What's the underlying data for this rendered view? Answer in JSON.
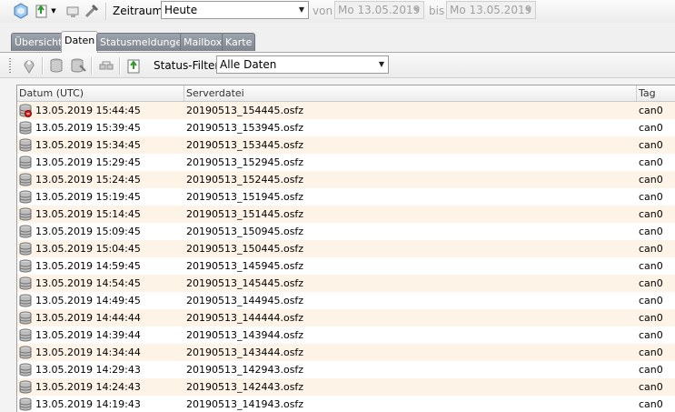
{
  "toolbar": {
    "zeitraum_label": "Zeitraum",
    "zeitraum_value": "Heute",
    "von_label": "von",
    "von_value": "Mo 13.05.2019",
    "bis_label": "bis",
    "bis_value": "Mo 13.05.2019"
  },
  "tabs": [
    {
      "label": "Übersicht"
    },
    {
      "label": "Daten"
    },
    {
      "label": "Statusmeldungen"
    },
    {
      "label": "Mailbox"
    },
    {
      "label": "Karte"
    }
  ],
  "filter": {
    "label": "Status-Filter:",
    "value": "Alle Daten"
  },
  "grid": {
    "columns": [
      "Datum (UTC)",
      "Serverdatei",
      "Tag"
    ],
    "rows": [
      {
        "date": "13.05.2019 15:44:45",
        "file": "20190513_154445.osfz",
        "tag": "can0",
        "icon": "database-alert-icon"
      },
      {
        "date": "13.05.2019 15:39:45",
        "file": "20190513_153945.osfz",
        "tag": "can0",
        "icon": "database-icon"
      },
      {
        "date": "13.05.2019 15:34:45",
        "file": "20190513_153445.osfz",
        "tag": "can0",
        "icon": "database-icon"
      },
      {
        "date": "13.05.2019 15:29:45",
        "file": "20190513_152945.osfz",
        "tag": "can0",
        "icon": "database-icon"
      },
      {
        "date": "13.05.2019 15:24:45",
        "file": "20190513_152445.osfz",
        "tag": "can0",
        "icon": "database-icon"
      },
      {
        "date": "13.05.2019 15:19:45",
        "file": "20190513_151945.osfz",
        "tag": "can0",
        "icon": "database-icon"
      },
      {
        "date": "13.05.2019 15:14:45",
        "file": "20190513_151445.osfz",
        "tag": "can0",
        "icon": "database-icon"
      },
      {
        "date": "13.05.2019 15:09:45",
        "file": "20190513_150945.osfz",
        "tag": "can0",
        "icon": "database-icon"
      },
      {
        "date": "13.05.2019 15:04:45",
        "file": "20190513_150445.osfz",
        "tag": "can0",
        "icon": "database-icon"
      },
      {
        "date": "13.05.2019 14:59:45",
        "file": "20190513_145945.osfz",
        "tag": "can0",
        "icon": "database-icon"
      },
      {
        "date": "13.05.2019 14:54:45",
        "file": "20190513_145445.osfz",
        "tag": "can0",
        "icon": "database-icon"
      },
      {
        "date": "13.05.2019 14:49:45",
        "file": "20190513_144945.osfz",
        "tag": "can0",
        "icon": "database-icon"
      },
      {
        "date": "13.05.2019 14:44:44",
        "file": "20190513_144444.osfz",
        "tag": "can0",
        "icon": "database-icon"
      },
      {
        "date": "13.05.2019 14:39:44",
        "file": "20190513_143944.osfz",
        "tag": "can0",
        "icon": "database-icon"
      },
      {
        "date": "13.05.2019 14:34:44",
        "file": "20190513_143444.osfz",
        "tag": "can0",
        "icon": "database-icon"
      },
      {
        "date": "13.05.2019 14:29:43",
        "file": "20190513_142943.osfz",
        "tag": "can0",
        "icon": "database-icon"
      },
      {
        "date": "13.05.2019 14:24:43",
        "file": "20190513_142443.osfz",
        "tag": "can0",
        "icon": "database-icon"
      },
      {
        "date": "13.05.2019 14:19:43",
        "file": "20190513_141943.osfz",
        "tag": "can0",
        "icon": "database-icon"
      }
    ]
  }
}
